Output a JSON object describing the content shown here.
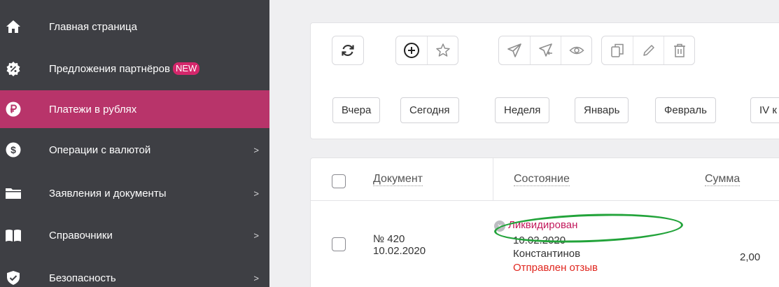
{
  "sidebar": {
    "items": [
      {
        "label": "Главная страница",
        "icon": "home-icon",
        "has_arrow": false
      },
      {
        "label": "Предложения партнёров",
        "badge": "NEW",
        "icon": "discount-badge-icon",
        "has_arrow": false
      },
      {
        "label": "Платежи в рублях",
        "icon": "ruble-icon",
        "has_arrow": false,
        "active": true
      },
      {
        "label": "Операции с валютой",
        "icon": "dollar-icon",
        "has_arrow": true
      },
      {
        "label": "Заявления и документы",
        "icon": "folder-icon",
        "has_arrow": true
      },
      {
        "label": "Справочники",
        "icon": "book-icon",
        "has_arrow": true
      },
      {
        "label": "Безопасность",
        "icon": "shield-icon",
        "has_arrow": true
      }
    ],
    "arrow_glyph": ">"
  },
  "toolbar": {
    "buttons": [
      "refresh-icon",
      "add-icon",
      "star-icon",
      "send-icon",
      "send-back-icon",
      "eye-icon",
      "copy-icon",
      "edit-icon",
      "delete-icon"
    ]
  },
  "filters": [
    "Вчера",
    "Сегодня",
    "Неделя",
    "Январь",
    "Февраль",
    "IV к"
  ],
  "table": {
    "headers": {
      "document": "Документ",
      "status": "Состояние",
      "amount": "Сумма"
    },
    "rows": [
      {
        "doc_number": "№ 420",
        "doc_date": "10.02.2020",
        "status": "Ликвидирован",
        "status_date": "10.02.2020",
        "status_user": "Константинов",
        "feedback": "Отправлен отзыв",
        "amount": "2,00"
      }
    ]
  },
  "colors": {
    "sidebar_bg": "#3e3f44",
    "active_bg": "#b8346a",
    "badge_bg": "#d4276b",
    "status_red": "#c2185b",
    "feedback_red": "#e0261e",
    "annotation_green": "#22a33a"
  }
}
